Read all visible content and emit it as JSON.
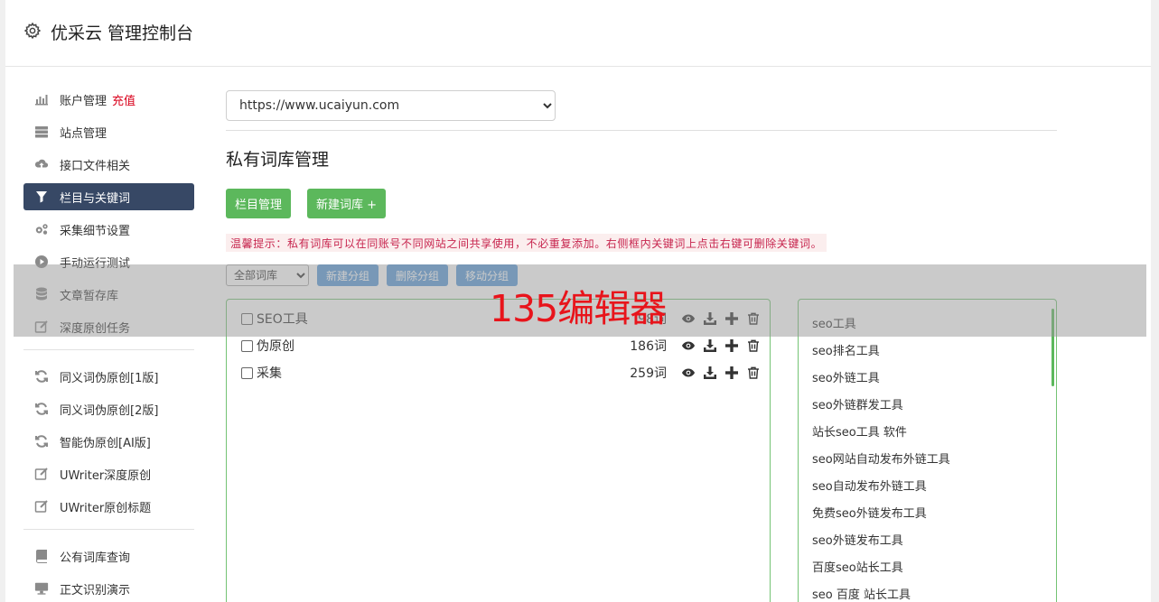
{
  "header": {
    "title": "优采云 管理控制台",
    "icon": "gear-icon"
  },
  "sidebar": {
    "groups": [
      [
        {
          "label": "账户管理",
          "badge": "充值",
          "icon": "bar-chart-icon",
          "active": false
        },
        {
          "label": "站点管理",
          "icon": "server-icon",
          "active": false
        },
        {
          "label": "接口文件相关",
          "icon": "cloud-upload-icon",
          "active": false
        },
        {
          "label": "栏目与关键词",
          "icon": "filter-icon",
          "active": true
        },
        {
          "label": "采集细节设置",
          "icon": "gears-icon",
          "active": false
        },
        {
          "label": "手动运行测试",
          "icon": "play-circle-icon",
          "active": false
        },
        {
          "label": "文章暂存库",
          "icon": "database-icon",
          "active": false
        },
        {
          "label": "深度原创任务",
          "icon": "edit-icon",
          "active": false
        }
      ],
      [
        {
          "label": "同义词伪原创[1版]",
          "icon": "refresh-icon"
        },
        {
          "label": "同义词伪原创[2版]",
          "icon": "refresh-icon"
        },
        {
          "label": "智能伪原创[AI版]",
          "icon": "refresh-icon"
        },
        {
          "label": "UWriter深度原创",
          "icon": "edit-icon"
        },
        {
          "label": "UWriter原创标题",
          "icon": "edit-icon"
        }
      ],
      [
        {
          "label": "公有词库查询",
          "icon": "book-icon"
        },
        {
          "label": "正文识别演示",
          "icon": "monitor-icon"
        }
      ]
    ]
  },
  "main": {
    "site_select": "https://www.ucaiyun.com",
    "page_title": "私有词库管理",
    "btn_column": "栏目管理",
    "btn_new_lib": "新建词库 +",
    "tip": "温馨提示：私有词库可以在同账号不同网站之间共享使用，不必重复添加。右侧框内关键词上点击右键可删除关键词。",
    "toolbar": {
      "lib_select": "全部词库",
      "btn_new_group": "新建分组",
      "btn_delete_group": "删除分组",
      "btn_move_group": "移动分组"
    },
    "libraries": [
      {
        "name": "SEO工具",
        "count": "98词"
      },
      {
        "name": "伪原创",
        "count": "186词"
      },
      {
        "name": "采集",
        "count": "259词"
      }
    ],
    "keywords": [
      "seo工具",
      "seo排名工具",
      "seo外链工具",
      "seo外链群发工具",
      "站长seo工具 软件",
      "seo网站自动发布外链工具",
      "seo自动发布外链工具",
      "免费seo外链发布工具",
      "seo外链发布工具",
      "百度seo站长工具",
      "seo 百度 站长工具"
    ]
  },
  "watermark": "135编辑器",
  "colors": {
    "green": "#5cb85c",
    "blue": "#5a9ad8",
    "active_nav": "#374865",
    "red": "#d9001b"
  }
}
